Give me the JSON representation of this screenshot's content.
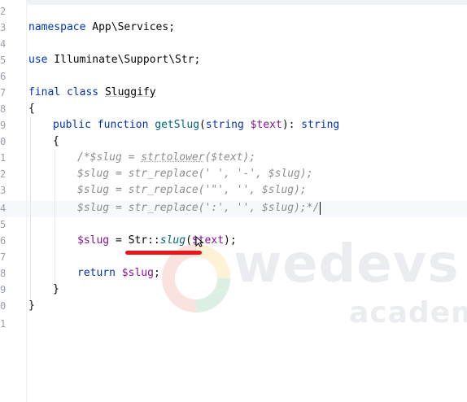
{
  "gutter": {
    "line_numbers": [
      "2",
      "3",
      "4",
      "5",
      "6",
      "7",
      "8",
      "9",
      "0",
      "1",
      "2",
      "3",
      "4",
      "5",
      "6",
      "7",
      "8",
      "9",
      "0",
      "1"
    ]
  },
  "code": {
    "namespace_kw": "namespace",
    "namespace_rest": " App\\Services;",
    "use_kw": "use",
    "use_rest": " Illuminate\\Support\\Str;",
    "final_kw": "final",
    "class_kw": "class",
    "class_name": "Sluggify",
    "brace_open": "{",
    "brace_close": "}",
    "public_kw": "public",
    "function_kw": "function",
    "method_name": "getSlug",
    "paren_open": "(",
    "param_type": "string",
    "param_var": "$text",
    "paren_close_colon": "): ",
    "return_type": "string",
    "inner_brace_open": "{",
    "inner_brace_close": "}",
    "comment_l1_a": "/*$slug = ",
    "comment_l1_fn": "strtolower",
    "comment_l1_b": "($text);",
    "comment_l2": "$slug = str_replace(' ', '-', $slug);",
    "comment_l3": "$slug = str_replace('\"', '', $slug);",
    "comment_l4": "$slug = str_replace(':', '', $slug);*/",
    "slug_var": "$slug",
    "assign": " = ",
    "str_class": "Str",
    "double_colon": "::",
    "slug_method": "slug",
    "call_open": "(",
    "call_arg": "$text",
    "call_close": ");",
    "return_kw": "return",
    "return_var": " $slug",
    "semicolon": ";"
  },
  "watermark": {
    "brand": "wedevs",
    "sub": "academy"
  },
  "colors": {
    "keyword": "#0033b3",
    "function": "#00627a",
    "variable": "#871094",
    "comment": "#8c8c8c",
    "highlight_underline": "#e8161b"
  }
}
